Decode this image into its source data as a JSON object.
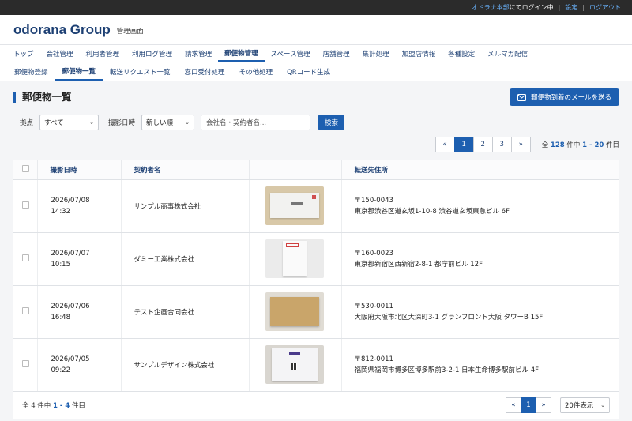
{
  "topbar": {
    "user": "オドラナ本部",
    "login_suffix": "にてログイン中",
    "settings": "設定",
    "logout": "ログアウト"
  },
  "header": {
    "brand": "odorana Group",
    "subtitle": "管理画面"
  },
  "main_nav": [
    "トップ",
    "会社管理",
    "利用者管理",
    "利用ログ管理",
    "請求管理",
    "郵便物管理",
    "スペース管理",
    "店舗管理",
    "集計処理",
    "加盟店情報",
    "各種設定",
    "メルマガ配信"
  ],
  "main_nav_active": 5,
  "sub_nav": [
    "郵便物登録",
    "郵便物一覧",
    "転送リクエスト一覧",
    "窓口受付処理",
    "その他処理",
    "QRコード生成"
  ],
  "sub_nav_active": 1,
  "page": {
    "title": "郵便物一覧",
    "mail_button": "郵便物到着のメールを送る"
  },
  "filters": {
    "location_label": "拠点",
    "location_value": "すべて",
    "date_label": "撮影日時",
    "date_value": "新しい順",
    "search_placeholder": "会社名・契約者名...",
    "search_button": "検索"
  },
  "pager_top": [
    "«",
    "1",
    "2",
    "3",
    "»"
  ],
  "pager_top_active": "1",
  "count_top": {
    "prefix": "全",
    "total": "128",
    "mid": "件中",
    "range": "1 - 20",
    "suffix": "件目"
  },
  "table": {
    "headers": {
      "date": "撮影日時",
      "name": "契約者名",
      "photo": "",
      "address": "転送先住所"
    },
    "rows": [
      {
        "date": "2026/07/08",
        "time": "14:32",
        "name": "サンプル商事株式会社",
        "zip": "〒150-0043",
        "address": "東京都渋谷区道玄坂1-10-8 渋谷道玄坂東急ビル 6F"
      },
      {
        "date": "2026/07/07",
        "time": "10:15",
        "name": "ダミー工業株式会社",
        "zip": "〒160-0023",
        "address": "東京都新宿区西新宿2-8-1 都庁前ビル 12F"
      },
      {
        "date": "2026/07/06",
        "time": "16:48",
        "name": "テスト企画合同会社",
        "zip": "〒530-0011",
        "address": "大阪府大阪市北区大深町3-1 グランフロント大阪 タワーB 15F"
      },
      {
        "date": "2026/07/05",
        "time": "09:22",
        "name": "サンプルデザイン株式会社",
        "zip": "〒812-0011",
        "address": "福岡県福岡市博多区博多駅前3-2-1 日本生命博多駅前ビル 4F"
      }
    ]
  },
  "footer": {
    "count_prefix": "全 4 件中",
    "count_range": "1 - 4",
    "count_suffix": "件目",
    "pager": [
      "«",
      "1",
      "»"
    ],
    "pager_active": "1",
    "per_page": "20件表示"
  },
  "colors": {
    "accent": "#1d5fb0",
    "brand": "#1c3f73",
    "topbar": "#2b2b2b"
  }
}
